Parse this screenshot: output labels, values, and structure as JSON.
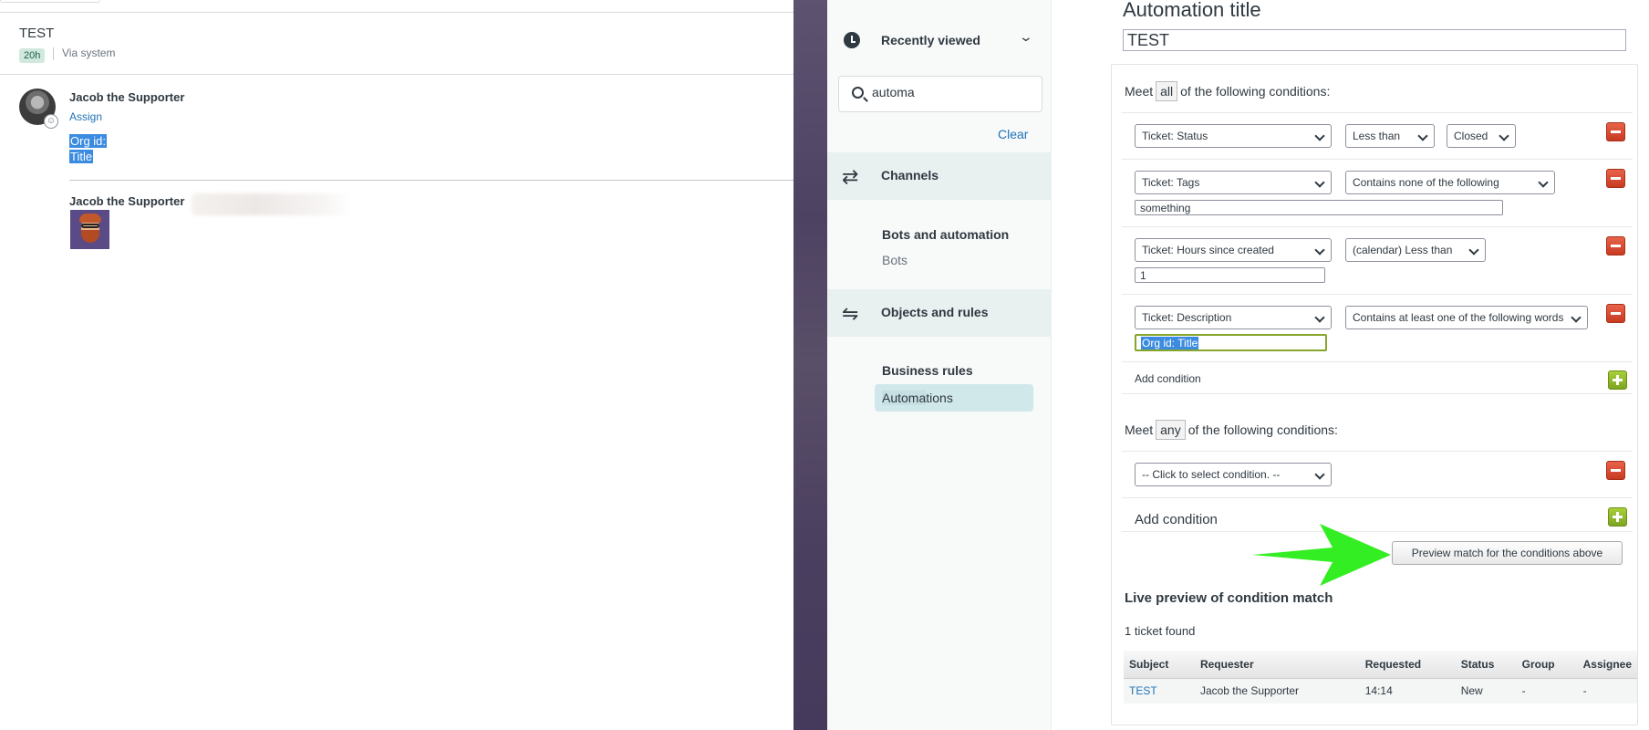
{
  "ticket": {
    "title": "TEST",
    "age_badge": "20h",
    "via": "Via system",
    "comment1": {
      "author": "Jacob the Supporter",
      "assign": "Assign",
      "lines": [
        "Org id:",
        "Title"
      ]
    },
    "comment2": {
      "author": "Jacob the Supporter"
    }
  },
  "nav": {
    "recently_viewed": "Recently viewed",
    "search_value": "automa",
    "clear": "Clear",
    "channels": "Channels",
    "bots_and_automation": "Bots and automation",
    "bots": "Bots",
    "objects_and_rules": "Objects and rules",
    "business_rules": "Business rules",
    "automations_match": "Automa",
    "automations_rest": "tions"
  },
  "form": {
    "heading": "Automation title",
    "title_value": "TEST",
    "all_prefix": "Meet",
    "all_pill": "all",
    "all_suffix": "of the following conditions:",
    "any_prefix": "Meet",
    "any_pill": "any",
    "any_suffix": "of the following conditions:",
    "conditions_all": [
      {
        "field": "Ticket: Status",
        "operator": "Less than",
        "value": "Closed"
      },
      {
        "field": "Ticket: Tags",
        "operator": "Contains none of the following",
        "text": "something"
      },
      {
        "field": "Ticket: Hours since created",
        "operator": "(calendar) Less than",
        "text": "1"
      },
      {
        "field": "Ticket: Description",
        "operator": "Contains at least one of the following words",
        "text": "Org id:  Title"
      }
    ],
    "add_condition": "Add condition",
    "any_placeholder": "-- Click to select condition. --",
    "add_condition_any": "Add condition",
    "preview_button": "Preview match for the conditions above",
    "live_preview": "Live preview of condition match",
    "found": "1 ticket found",
    "table": {
      "headers": [
        "Subject",
        "Requester",
        "Requested",
        "Status",
        "Group",
        "Assignee"
      ],
      "rows": [
        [
          "TEST",
          "Jacob the Supporter",
          "14:14",
          "New",
          "-",
          "-"
        ]
      ]
    }
  },
  "colors": {
    "link": "#1f73b7",
    "selection": "#3b8be0",
    "arrow": "#33ee22",
    "remove_button": "#d9472c",
    "add_button": "#8fb92b"
  }
}
